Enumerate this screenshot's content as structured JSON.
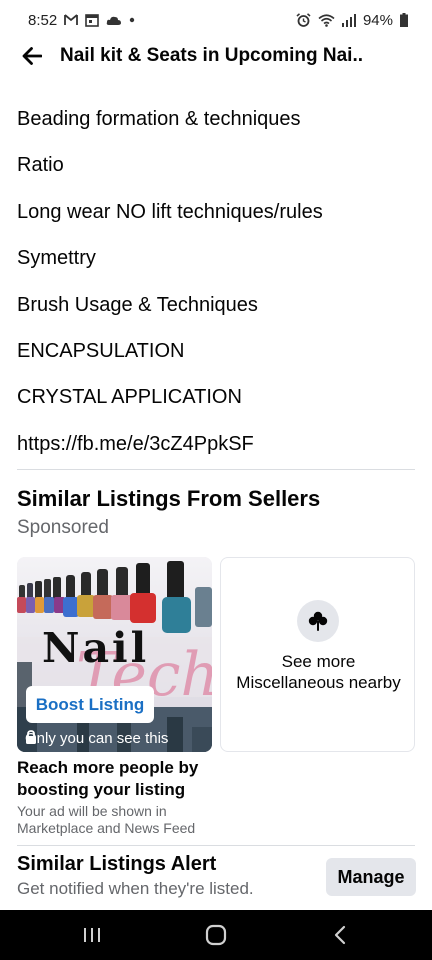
{
  "status_bar": {
    "time": "8:52",
    "battery": "94%"
  },
  "header": {
    "title": "Nail kit & Seats in Upcoming Nai.."
  },
  "description_lines": [
    "Beading formation & techniques",
    "Ratio",
    "Long wear NO lift techniques/rules",
    "Symettry",
    "Brush Usage & Techniques",
    "ENCAPSULATION",
    "CRYSTAL APPLICATION",
    "https://fb.me/e/3cZ4PpkSF"
  ],
  "similar": {
    "title": "Similar Listings From Sellers",
    "subtitle": "Sponsored",
    "ad_card": {
      "brand_word": "Nail",
      "brand_script": "Tech",
      "boost_label": "Boost Listing",
      "privacy_note": "Only you can see this"
    },
    "more_card": {
      "label": "See more Miscellaneous nearby"
    },
    "boost_headline": "Reach more people by boosting your listing",
    "boost_description": "Your ad will be shown in Marketplace and News Feed"
  },
  "alert": {
    "title": "Similar Listings Alert",
    "subtitle": "Get notified when they're listed.",
    "manage_label": "Manage"
  },
  "icons": {
    "back": "arrow-left-icon",
    "lock": "lock-icon",
    "clover": "clover-icon"
  },
  "colors": {
    "accent": "#1a6fc4",
    "secondary_text": "#65676b",
    "button_bg": "#e4e6eb"
  }
}
